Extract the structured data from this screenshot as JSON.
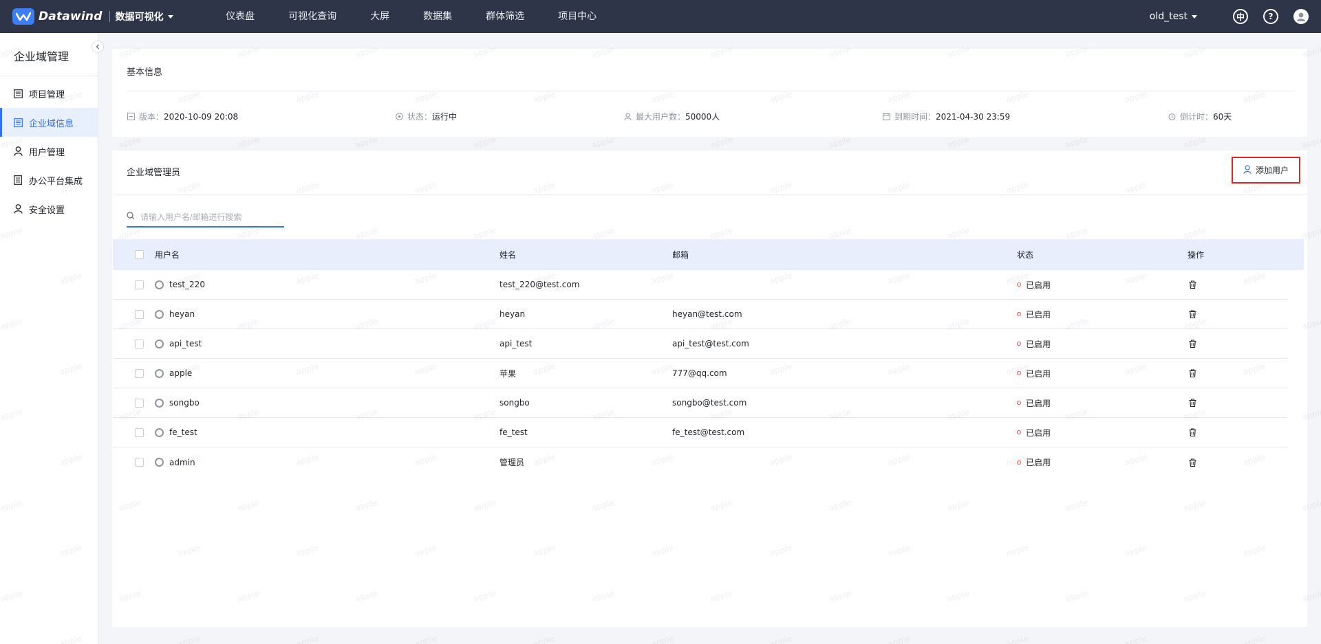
{
  "header": {
    "brand": "Datawind",
    "app_switch": "数据可视化",
    "nav": [
      {
        "label": "仪表盘"
      },
      {
        "label": "可视化查询"
      },
      {
        "label": "大屏"
      },
      {
        "label": "数据集"
      },
      {
        "label": "群体筛选"
      },
      {
        "label": "项目中心"
      }
    ],
    "user": "old_test",
    "lang_label": "中",
    "help_label": "?"
  },
  "sidebar": {
    "title": "企业域管理",
    "items": [
      {
        "label": "项目管理",
        "icon": "list-icon",
        "active": false
      },
      {
        "label": "企业域信息",
        "icon": "list-icon",
        "active": true
      },
      {
        "label": "用户管理",
        "icon": "user-icon",
        "active": false
      },
      {
        "label": "办公平台集成",
        "icon": "document-icon",
        "active": false
      },
      {
        "label": "安全设置",
        "icon": "user-icon",
        "active": false
      }
    ]
  },
  "basic_info": {
    "title": "基本信息",
    "version_label": "版本：",
    "version": "2020-10-09 20:08",
    "status_label": "状态：",
    "status": "运行中",
    "max_users_label": "最大用户数：",
    "max_users": "50000人",
    "expire_label": "到期时间：",
    "expire": "2021-04-30 23:59",
    "countdown_label": "倒计时：",
    "countdown": "60天"
  },
  "admins": {
    "title": "企业域管理员",
    "add_button": "添加用户",
    "search_placeholder": "请输入用户名/邮箱进行搜索",
    "columns": {
      "username": "用户名",
      "name": "姓名",
      "email": "邮箱",
      "status": "状态",
      "action": "操作"
    },
    "rows": [
      {
        "username": "test_220",
        "name": "test_220@test.com",
        "email": "",
        "status": "已启用"
      },
      {
        "username": "heyan",
        "name": "heyan",
        "email": "heyan@test.com",
        "status": "已启用"
      },
      {
        "username": "api_test",
        "name": "api_test",
        "email": "api_test@test.com",
        "status": "已启用"
      },
      {
        "username": "apple",
        "name": "苹果",
        "email": "777@qq.com",
        "status": "已启用"
      },
      {
        "username": "songbo",
        "name": "songbo",
        "email": "songbo@test.com",
        "status": "已启用"
      },
      {
        "username": "fe_test",
        "name": "fe_test",
        "email": "fe_test@test.com",
        "status": "已启用"
      },
      {
        "username": "admin",
        "name": "管理员",
        "email": "",
        "status": "已启用"
      }
    ]
  },
  "watermark": "apple",
  "colors": {
    "topbar": "#2f3549",
    "accent": "#3370ff",
    "highlight_border": "#e12525",
    "status_dot": "#f54a45"
  }
}
